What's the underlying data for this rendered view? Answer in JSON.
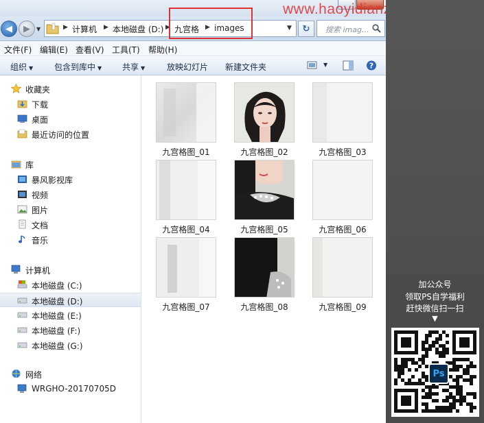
{
  "watermark": "www.haoyidianzheji.com",
  "address_bar": {
    "breadcrumbs": [
      "计算机",
      "本地磁盘 (D:)",
      "九宫格",
      "images"
    ],
    "search_placeholder": "搜索 imag..."
  },
  "menu": [
    "文件(F)",
    "编辑(E)",
    "查看(V)",
    "工具(T)",
    "帮助(H)"
  ],
  "toolbar": {
    "organize": "组织",
    "include_in_library": "包含到库中",
    "share": "共享",
    "slideshow": "放映幻灯片",
    "new_folder": "新建文件夹"
  },
  "nav": {
    "favorites": {
      "title": "收藏夹",
      "items": [
        "下载",
        "桌面",
        "最近访问的位置"
      ]
    },
    "libraries": {
      "title": "库",
      "items": [
        "暴风影视库",
        "视频",
        "图片",
        "文档",
        "音乐"
      ]
    },
    "computer": {
      "title": "计算机",
      "items": [
        "本地磁盘 (C:)",
        "本地磁盘 (D:)",
        "本地磁盘 (E:)",
        "本地磁盘 (F:)",
        "本地磁盘 (G:)"
      ],
      "selected": "本地磁盘 (D:)"
    },
    "network": {
      "title": "网络",
      "items": [
        "WRGHO-20170705D"
      ]
    }
  },
  "files": [
    "九宫格图_01",
    "九宫格图_02",
    "九宫格图_03",
    "九宫格图_04",
    "九宫格图_05",
    "九宫格图_06",
    "九宫格图_07",
    "九宫格图_08",
    "九宫格图_09"
  ],
  "promo": {
    "lines": [
      "加公众号",
      "领取PS自学福利",
      "赶快微信扫一扫"
    ],
    "arrow": "▼",
    "qr_badge": "Ps"
  },
  "colors": {
    "highlight_box": "#e03030",
    "watermark": "#e0383a",
    "promo_bg": "#4a4a4a"
  }
}
